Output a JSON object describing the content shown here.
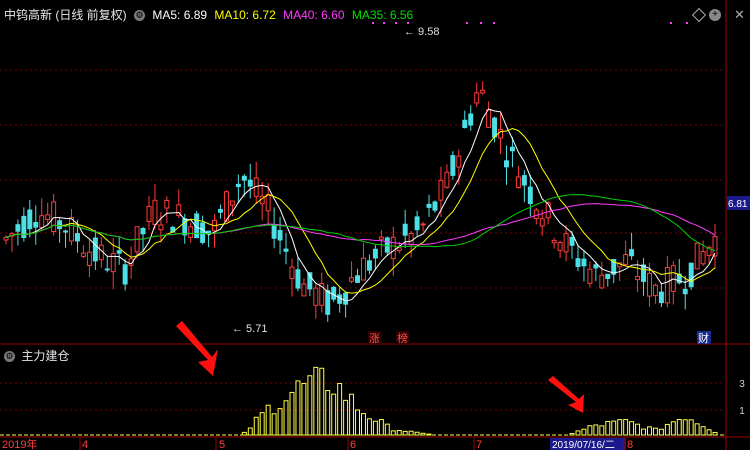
{
  "header": {
    "title": "中钨高新 (日线 前复权)",
    "ma5": "MA5: 6.89",
    "ma10": "MA10: 6.72",
    "ma40": "MA40: 6.60",
    "ma35": "MA35: 6.56"
  },
  "icons": {
    "settings": "gear-icon",
    "diamond": "diamond-icon",
    "zoom": "zoom-icon",
    "close": "close-icon"
  },
  "price_labels": {
    "high": "9.58",
    "low": "5.71",
    "current": "6.81"
  },
  "markers": {
    "zhang": "涨",
    "bang": "榜",
    "cai": "财"
  },
  "indicator": {
    "title": "主力建仓",
    "scale_3": "3",
    "scale_1": "1"
  },
  "time_axis": {
    "year": "2019年",
    "m4": "4",
    "m5": "5",
    "m6": "6",
    "m7": "7",
    "cursor_date": "2019/07/16/二",
    "m8": "8"
  },
  "colors": {
    "up": "#ff3b3b",
    "down": "#4ce0e6",
    "ma5": "#ffffff",
    "ma10": "#ffff00",
    "ma40": "#ff3cff",
    "ma35": "#00d000",
    "grid": "#7a0000",
    "bar": "#ffff40"
  },
  "chart_data": {
    "type": "candlestick",
    "ohlc_sampled": [
      [
        6.5,
        6.9,
        6.3,
        6.8
      ],
      [
        6.8,
        7.4,
        6.7,
        7.2
      ],
      [
        7.2,
        7.5,
        6.9,
        7.0
      ],
      [
        7.0,
        7.1,
        6.5,
        6.6
      ],
      [
        6.6,
        6.8,
        6.1,
        6.4
      ],
      [
        6.4,
        7.3,
        6.3,
        7.2
      ],
      [
        7.2,
        7.4,
        6.9,
        7.1
      ],
      [
        7.1,
        7.5,
        6.8,
        6.9
      ],
      [
        6.9,
        7.8,
        6.8,
        7.7
      ],
      [
        7.7,
        7.8,
        7.0,
        7.1
      ],
      [
        7.1,
        7.2,
        6.0,
        6.2
      ],
      [
        6.2,
        6.3,
        5.71,
        5.9
      ],
      [
        5.9,
        6.5,
        5.8,
        6.4
      ],
      [
        6.4,
        6.8,
        6.2,
        6.7
      ],
      [
        6.7,
        7.0,
        6.4,
        6.9
      ],
      [
        6.9,
        7.8,
        6.8,
        7.6
      ],
      [
        7.6,
        9.58,
        7.5,
        8.9
      ],
      [
        8.9,
        9.2,
        7.8,
        8.0
      ],
      [
        8.0,
        8.1,
        7.2,
        7.3
      ],
      [
        7.3,
        7.4,
        6.6,
        6.7
      ],
      [
        6.7,
        6.9,
        6.2,
        6.3
      ],
      [
        6.3,
        6.6,
        6.1,
        6.5
      ],
      [
        6.5,
        6.7,
        6.0,
        6.1
      ],
      [
        6.1,
        6.4,
        5.9,
        6.3
      ],
      [
        6.3,
        6.9,
        6.2,
        6.81
      ]
    ],
    "indicator_values": [
      0,
      0,
      0,
      0,
      0,
      0,
      0,
      0,
      0,
      1.8,
      2.9,
      3.3,
      1.5,
      0.4,
      0.1,
      0,
      0,
      0,
      0,
      0,
      0.6,
      0.8,
      0.3,
      1.2,
      0.2
    ],
    "price_range": [
      5.5,
      9.8
    ],
    "indicator_range": [
      0,
      4
    ]
  }
}
